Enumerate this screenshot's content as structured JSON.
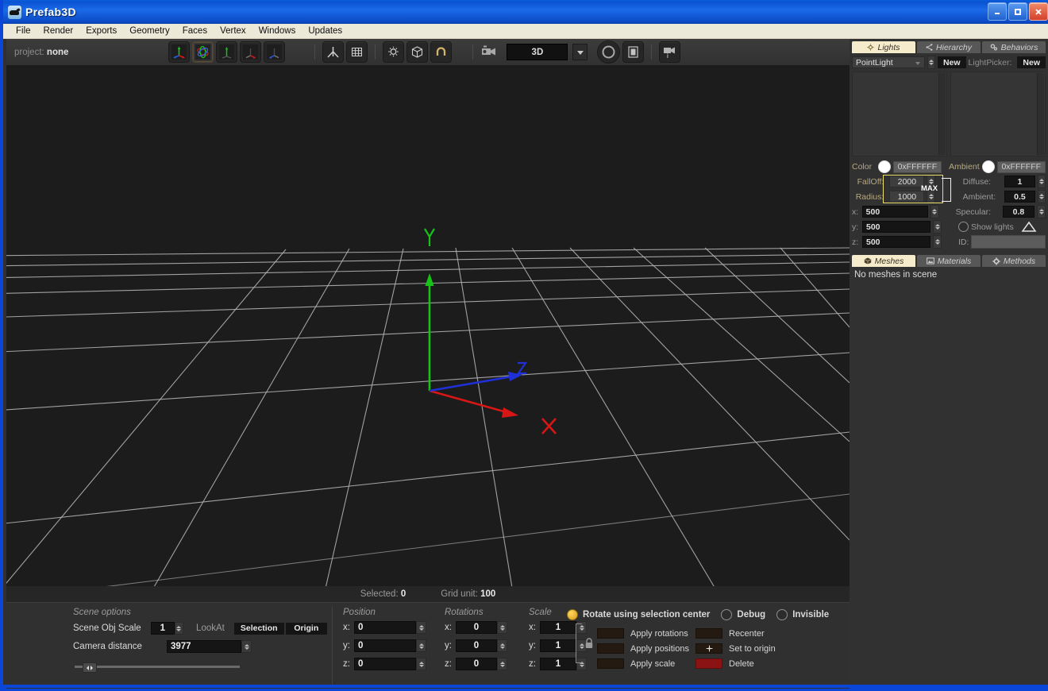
{
  "window": {
    "title": "Prefab3D",
    "icon": "app-icon",
    "buttons": {
      "minimize": "minimize-icon",
      "maximize": "maximize-icon",
      "close": "close-icon"
    }
  },
  "menubar": {
    "items": [
      "File",
      "Render",
      "Exports",
      "Geometry",
      "Faces",
      "Vertex",
      "Windows",
      "Updates"
    ]
  },
  "toolbar": {
    "project_label": "project:",
    "project_value": "none",
    "gizmo_buttons": [
      {
        "name": "translate-gizmo-icon",
        "active": false
      },
      {
        "name": "rotate-gizmo-icon",
        "active": true
      },
      {
        "name": "scale-y-gizmo-icon",
        "active": false
      },
      {
        "name": "scale-gizmo-icon",
        "active": false
      },
      {
        "name": "axis-gizmo-icon",
        "active": false
      }
    ],
    "view_buttons": [
      {
        "name": "pivot-icon"
      },
      {
        "name": "grid-icon"
      }
    ],
    "display_buttons": [
      {
        "name": "light-bulb-icon"
      },
      {
        "name": "wireframe-cube-icon"
      },
      {
        "name": "magnet-snap-icon"
      }
    ],
    "camera_icon": "camera-icon",
    "camera_mode": "3D",
    "camera_dropdown_icon": "chevron-down-icon",
    "shape_buttons": [
      {
        "name": "circle-icon"
      },
      {
        "name": "screen-icon"
      }
    ],
    "camera_info_icon": "camera-info-icon"
  },
  "viewport": {
    "axis_labels": {
      "x": "X",
      "y": "Y",
      "z": "Z"
    },
    "axis_colors": {
      "x": "#d81616",
      "y": "#18c218",
      "z": "#1f30d8"
    },
    "grid_color": "#b0b0b0",
    "background": "#1c1c1c",
    "status": {
      "selected_label": "Selected:",
      "selected_value": "0",
      "grid_unit_label": "Grid unit:",
      "grid_unit_value": "100"
    }
  },
  "right_panel": {
    "top_tabs": [
      {
        "label": "Lights",
        "icon": "light-bulb-icon",
        "active": true
      },
      {
        "label": "Hierarchy",
        "icon": "share-nodes-icon",
        "active": false
      },
      {
        "label": "Behaviors",
        "icon": "gears-icon",
        "active": false
      }
    ],
    "light_type": "PointLight",
    "new_light_button": "New",
    "lightpicker_label": "LightPicker:",
    "lightpicker_new_button": "New",
    "color_label": "Color",
    "color_value": "0xFFFFFF",
    "ambient_color_label": "Ambient",
    "ambient_color_value": "0xFFFFFF",
    "falloff_label": "FallOff:",
    "falloff_value": "2000",
    "radius_label": "Radius:",
    "radius_value": "1000",
    "max_bracket_label": "MAX",
    "diffuse_label": "Diffuse:",
    "diffuse_value": "1",
    "ambient_label": "Ambient:",
    "ambient_value": "0.5",
    "specular_label": "Specular:",
    "specular_value": "0.8",
    "pos_x_label": "x:",
    "pos_x_value": "500",
    "pos_y_label": "y:",
    "pos_y_value": "500",
    "pos_z_label": "z:",
    "pos_z_value": "500",
    "show_lights_label": "Show lights",
    "show_lights_checked": false,
    "show_lights_icon": "triangle-icon",
    "id_label": "ID:",
    "id_value": "",
    "bottom_tabs": [
      {
        "label": "Meshes",
        "icon": "cube-icon",
        "active": true
      },
      {
        "label": "Materials",
        "icon": "image-icon",
        "active": false
      },
      {
        "label": "Methods",
        "icon": "gear-icon",
        "active": false
      }
    ],
    "mesh_list_empty": "No meshes in scene",
    "highlight_color": "#e8e06a"
  },
  "bottom_panel": {
    "scene_options": {
      "title": "Scene options",
      "obj_scale_label": "Scene Obj Scale",
      "obj_scale_value": "1",
      "camera_distance_label": "Camera distance",
      "camera_distance_value": "3977",
      "lookat_label": "LookAt",
      "lookat_selection": "Selection",
      "lookat_origin": "Origin"
    },
    "transform": {
      "position_title": "Position",
      "rotations_title": "Rotations",
      "scale_title": "Scale",
      "axis_labels": [
        "x:",
        "y:",
        "z:"
      ],
      "position_values": [
        "0",
        "0",
        "0"
      ],
      "rotation_values": [
        "0",
        "0",
        "0"
      ],
      "scale_values": [
        "1",
        "1",
        "1"
      ],
      "lock_icon": "lock-icon"
    },
    "options": {
      "rotate_center_label": "Rotate using selection center",
      "rotate_center_checked": true,
      "debug_label": "Debug",
      "debug_checked": false,
      "invisible_label": "Invisible",
      "invisible_checked": false
    },
    "actions_left": [
      {
        "label": "Apply rotations",
        "color": "#241a12"
      },
      {
        "label": "Apply positions",
        "color": "#241a12"
      },
      {
        "label": "Apply scale",
        "color": "#241a12"
      }
    ],
    "actions_right": [
      {
        "label": "Recenter",
        "color": "#241a12",
        "icon": ""
      },
      {
        "label": "Set to origin",
        "color": "#241a12",
        "icon": "move-icon"
      },
      {
        "label": "Delete",
        "color": "#8c1313",
        "icon": ""
      }
    ]
  }
}
